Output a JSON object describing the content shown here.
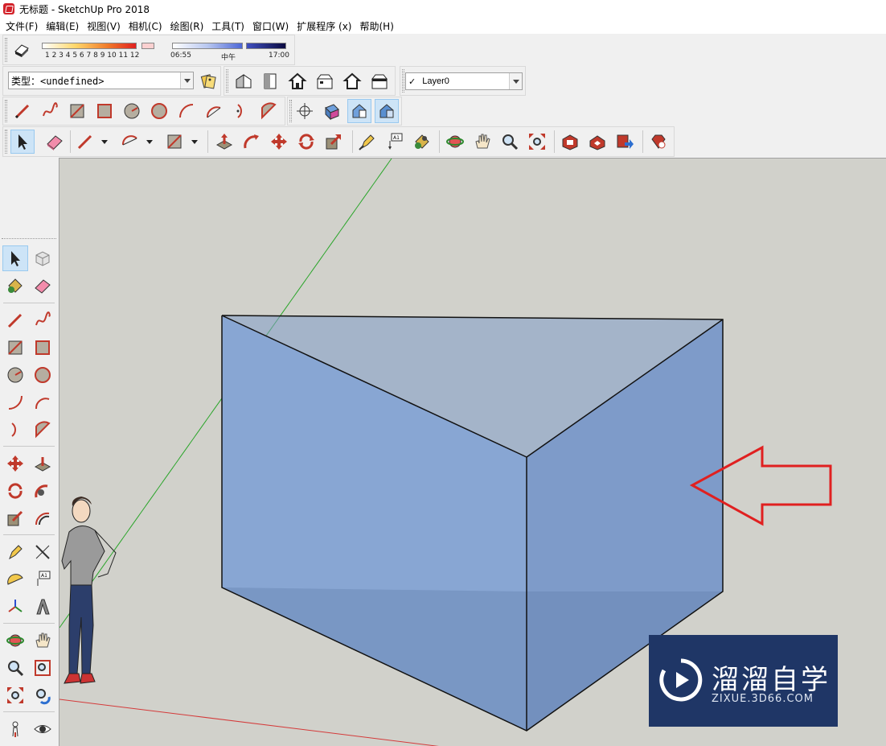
{
  "window": {
    "title": "无标题 - SketchUp Pro 2018"
  },
  "menu": [
    "文件(F)",
    "编辑(E)",
    "视图(V)",
    "相机(C)",
    "绘图(R)",
    "工具(T)",
    "窗口(W)",
    "扩展程序 (x)",
    "帮助(H)"
  ],
  "shadows": {
    "month_labels": "1 2 3 4 5 6 7 8 9 10 11 12",
    "time_start": "06:55",
    "time_mid": "中午",
    "time_end": "17:00"
  },
  "type_selector": {
    "value": "类型：<undefined>"
  },
  "layer_selector": {
    "check": "✓",
    "value": "Layer0"
  },
  "viewport": {
    "background": "#d1d1cb",
    "face_colors": {
      "left": "#88a6d3",
      "right": "#7e9bc9",
      "top": "#7f9cc8",
      "bottom": "#6a86b5"
    },
    "annotation_arrow_color": "#e02020"
  },
  "watermark": {
    "brand": "溜溜自学",
    "url": "ZIXUE.3D66.COM"
  }
}
